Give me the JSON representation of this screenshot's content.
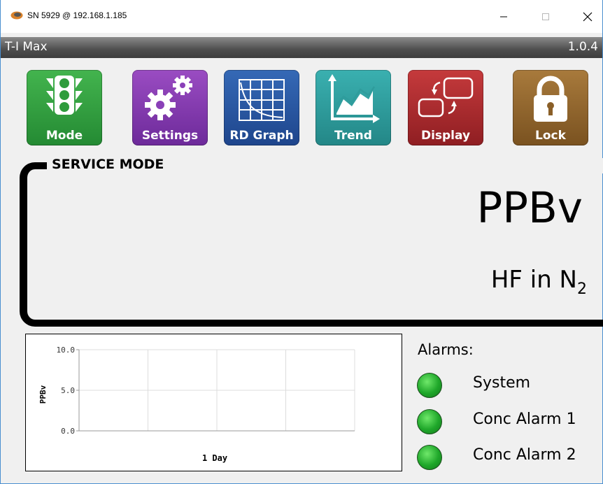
{
  "window": {
    "title": "SN 5929 @ 192.168.1.185",
    "controls": {
      "minimize": "minimize-icon",
      "maximize": "maximize-icon",
      "close": "close-icon"
    }
  },
  "app": {
    "name": "T-I Max",
    "version": "1.0.4"
  },
  "toolbar": {
    "items": [
      {
        "label": "Mode",
        "icon": "traffic-light-icon",
        "color": "#2e9c3c"
      },
      {
        "label": "Settings",
        "icon": "gears-icon",
        "color": "#7f36ab"
      },
      {
        "label": "RD Graph",
        "icon": "grid-graph-icon",
        "color": "#2a58a2"
      },
      {
        "label": "Trend",
        "icon": "trend-chart-icon",
        "color": "#2f9c9c"
      },
      {
        "label": "Display",
        "icon": "swap-display-icon",
        "color": "#ad2b2f"
      },
      {
        "label": "Lock",
        "icon": "padlock-icon",
        "color": "#94672e"
      }
    ]
  },
  "readout": {
    "mode_label": "SERVICE MODE",
    "units": "PPBv",
    "gas_prefix": "HF in N",
    "gas_subscript": "2"
  },
  "chart_data": {
    "type": "line",
    "ylabel": "PPBv",
    "xlabel": "1 Day",
    "ylim": [
      0.0,
      10.0
    ],
    "yticks": [
      "10.0",
      "5.0",
      "0.0"
    ],
    "grid": true,
    "series": []
  },
  "alarms": {
    "title": "Alarms:",
    "items": [
      {
        "label": "System",
        "status_color": "#2bb536"
      },
      {
        "label": "Conc Alarm 1",
        "status_color": "#2bb536"
      },
      {
        "label": "Conc Alarm 2",
        "status_color": "#2bb536"
      }
    ]
  }
}
